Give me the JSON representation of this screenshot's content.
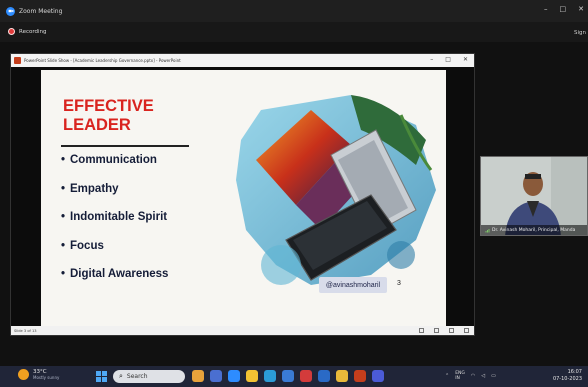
{
  "zoom": {
    "window_title": "Zoom Meeting",
    "recording_label": "Recording",
    "sign_label": "Sign",
    "controls": [
      "–",
      "□",
      "✕"
    ]
  },
  "powerpoint": {
    "window_title": "PowerPoint Slide Show - [Academic Leadership Governance.pptx] - PowerPoint",
    "controls": [
      "–",
      "□",
      "✕"
    ],
    "status_text": "Slide 3 of 13",
    "slide": {
      "heading_line1": "EFFECTIVE",
      "heading_line2": "LEADER",
      "bullets": [
        "Communication",
        "Empathy",
        "Indomitable Spirit",
        "Focus",
        "Digital Awareness"
      ],
      "handle": "@avinashmoharil",
      "slide_number": "3"
    }
  },
  "participant": {
    "name_label": "Dr. Avinash Moharil, Principal, Manda"
  },
  "taskbar": {
    "temperature": "33°C",
    "weather_desc": "Mostly sunny",
    "search_placeholder": "Search",
    "lang_primary": "ENG",
    "lang_secondary": "IN",
    "time": "16:07",
    "date": "07-10-2023"
  },
  "colors": {
    "heading_red": "#d9241f",
    "bullet_navy": "#151d38",
    "taskbar_bg": "#202538",
    "recording_red": "#e03a3a"
  }
}
